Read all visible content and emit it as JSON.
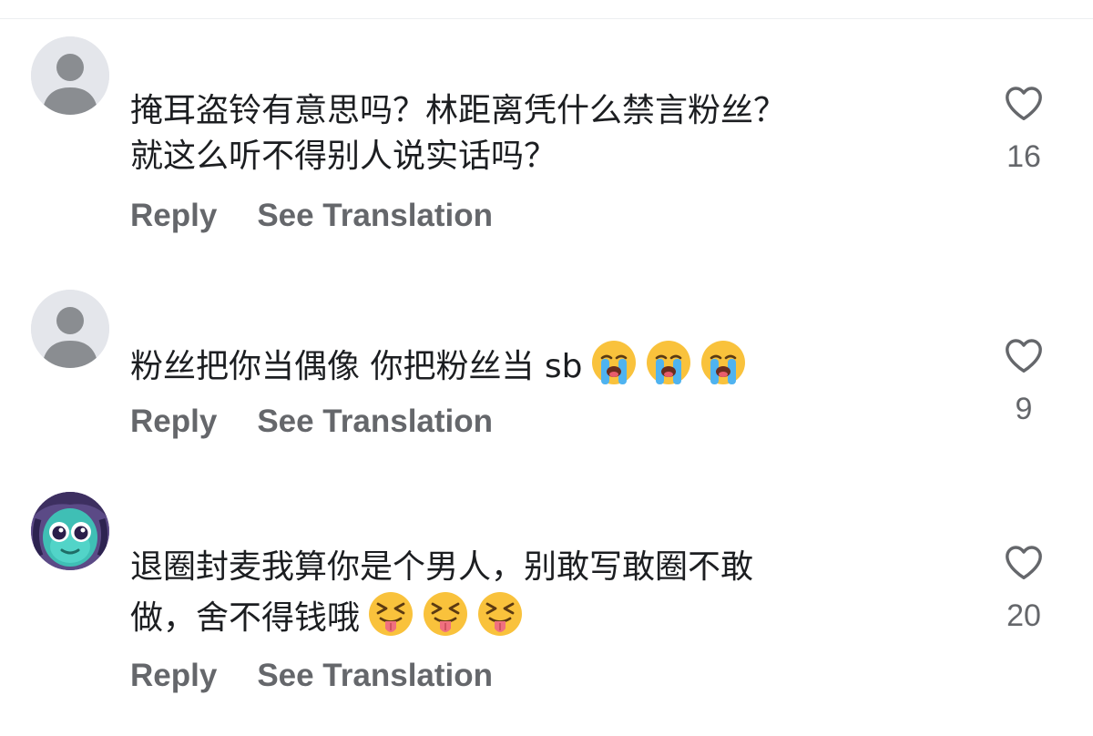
{
  "comments": [
    {
      "avatar_icon": "default-user-icon",
      "text_line_1": "掩耳盗铃有意思吗？林距离凭什么禁言粉丝？",
      "text_line_2": "就这么听不得别人说实话吗？",
      "reply_label": "Reply",
      "translate_label": "See Translation",
      "like_icon": "heart-outline-icon",
      "likes": "16"
    },
    {
      "avatar_icon": "default-user-icon",
      "text_line_1": "粉丝把你当偶像 你把粉丝当 sb",
      "emojis": [
        "loudly-crying-face",
        "loudly-crying-face",
        "loudly-crying-face"
      ],
      "reply_label": "Reply",
      "translate_label": "See Translation",
      "like_icon": "heart-outline-icon",
      "likes": "9"
    },
    {
      "avatar_icon": "cartoon-character-avatar",
      "text_line_1": "退圈封麦我算你是个男人，别敢写敢圈不敢",
      "text_line_2": "做，舍不得钱哦",
      "emojis": [
        "squinting-face-with-tongue",
        "squinting-face-with-tongue",
        "squinting-face-with-tongue"
      ],
      "reply_label": "Reply",
      "translate_label": "See Translation",
      "like_icon": "heart-outline-icon",
      "likes": "20"
    }
  ],
  "colors": {
    "text": "#1c1e21",
    "secondary": "#65676b",
    "avatar_bg": "#e4e6eb",
    "avatar_silhouette": "#8a8d91"
  }
}
